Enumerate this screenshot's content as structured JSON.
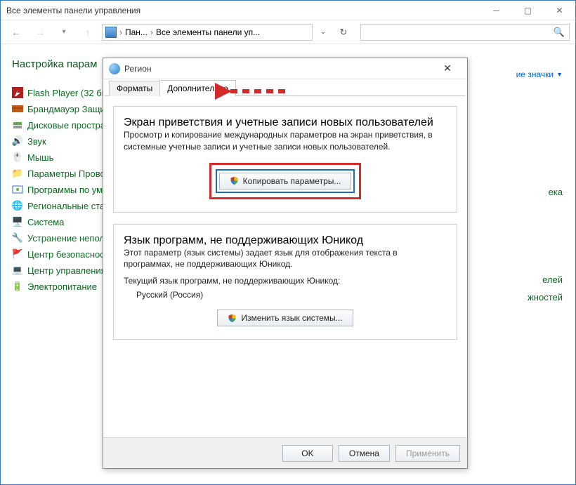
{
  "cp": {
    "title": "Все элементы панели управления",
    "bc1": "Пан...",
    "bc2": "Все элементы панели уп...",
    "heading": "Настройка парам",
    "view": "ие значки",
    "items": [
      "Flash Player (32 бит",
      "Брандмауэр Защи",
      "Дисковые простра",
      "Звук",
      "Мышь",
      "Параметры Прово",
      "Программы по ум",
      "Региональные ста",
      "Система",
      "Устранение непол",
      "Центр безопасност",
      "Центр управления",
      "Электропитание"
    ],
    "right_peek": [
      "ека",
      "елей",
      "жностей"
    ]
  },
  "dlg": {
    "title": "Регион",
    "tabs": {
      "formats": "Форматы",
      "advanced": "Дополнительно"
    },
    "group1": {
      "legend": "Экран приветствия и учетные записи новых пользователей",
      "desc": "Просмотр и копирование международных параметров на экран приветствия, в системные учетные записи и учетные записи новых пользователей.",
      "button": "Копировать параметры..."
    },
    "group2": {
      "legend": "Язык программ, не поддерживающих Юникод",
      "desc": "Этот параметр (язык системы) задает язык для отображения текста в программах, не поддерживающих Юникод.",
      "current_label": "Текущий язык программ, не поддерживающих Юникод:",
      "current_value": "Русский (Россия)",
      "button": "Изменить язык системы..."
    },
    "footer": {
      "ok": "OK",
      "cancel": "Отмена",
      "apply": "Применить"
    }
  }
}
